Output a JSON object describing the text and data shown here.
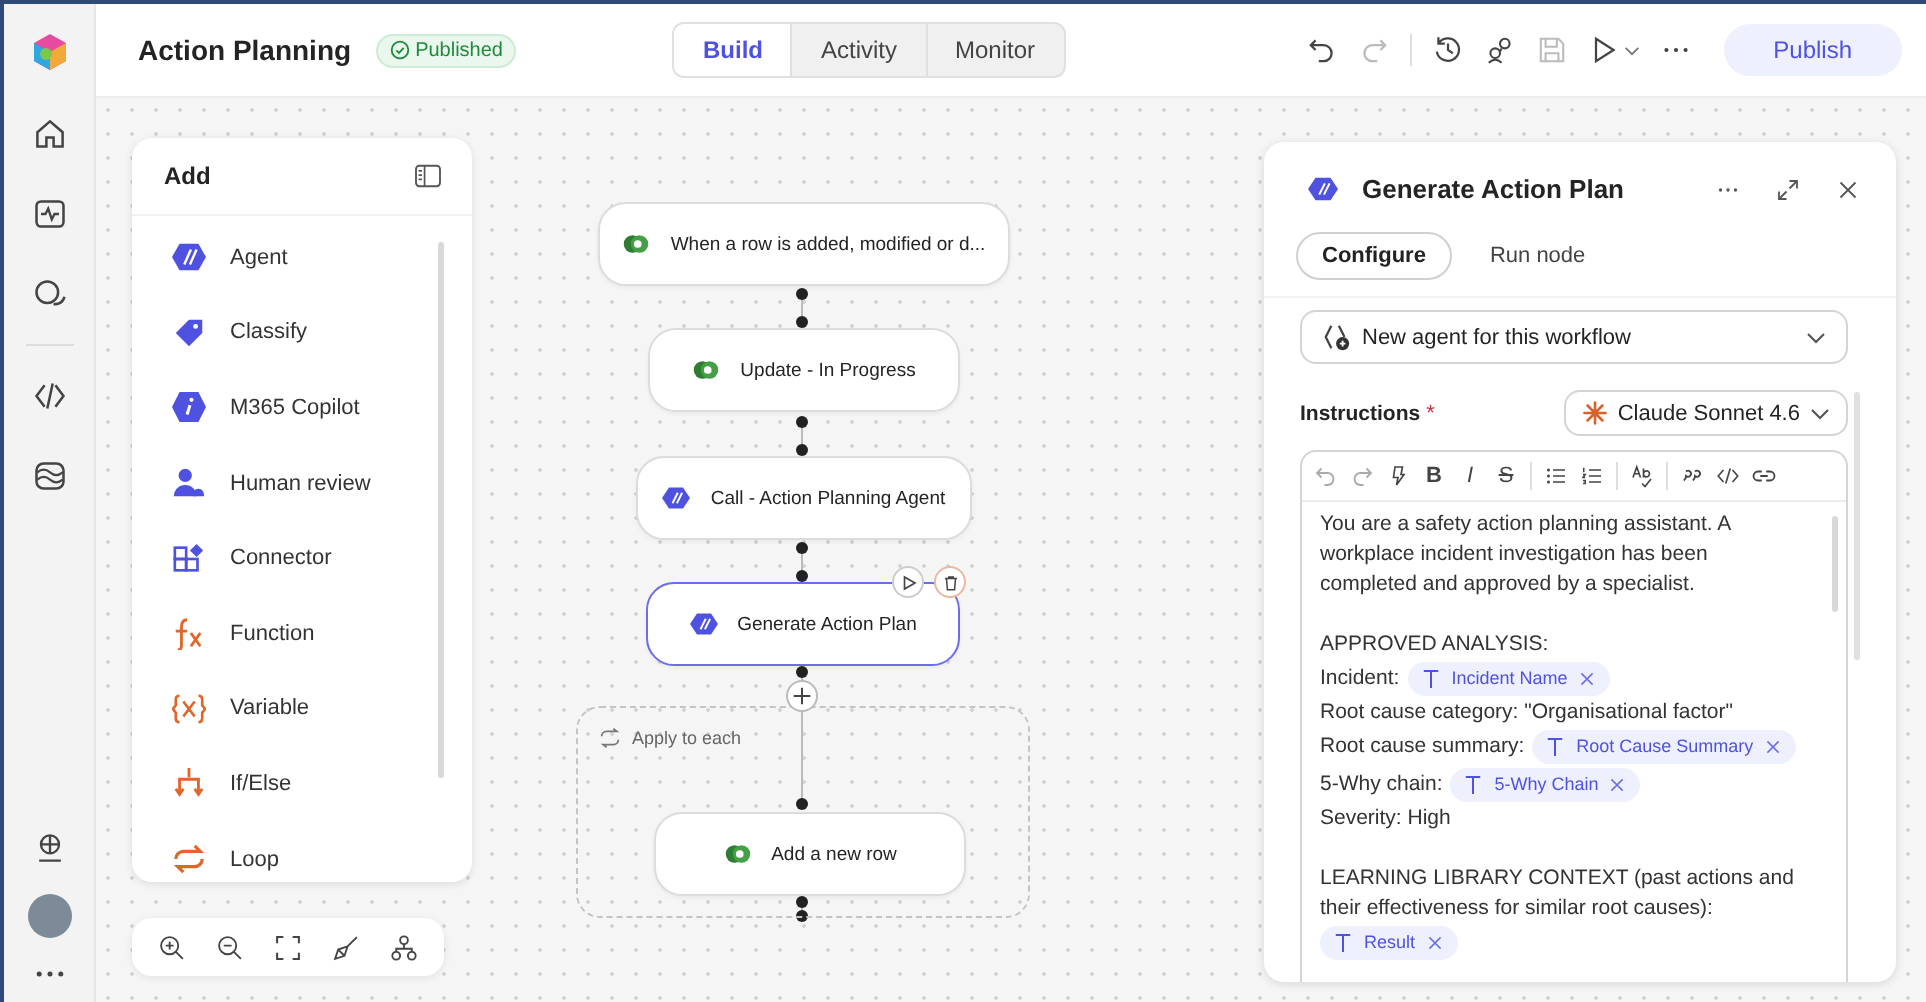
{
  "app": {
    "title": "Action Planning",
    "status": "Published"
  },
  "view_tabs": [
    {
      "label": "Build",
      "selected": true
    },
    {
      "label": "Activity",
      "selected": false
    },
    {
      "label": "Monitor",
      "selected": false
    }
  ],
  "publish_button": "Publish",
  "add_panel": {
    "title": "Add",
    "items": [
      {
        "label": "Agent",
        "kind": "agent"
      },
      {
        "label": "Classify",
        "kind": "classify"
      },
      {
        "label": "M365 Copilot",
        "kind": "copilot"
      },
      {
        "label": "Human review",
        "kind": "human"
      },
      {
        "label": "Connector",
        "kind": "connector"
      },
      {
        "label": "Function",
        "kind": "function"
      },
      {
        "label": "Variable",
        "kind": "variable"
      },
      {
        "label": "If/Else",
        "kind": "ifelse"
      },
      {
        "label": "Loop",
        "kind": "loop"
      }
    ]
  },
  "workflow": {
    "nodes": [
      {
        "label": "When a row is added, modified or d...",
        "kind": "dataverse",
        "selected": false
      },
      {
        "label": "Update - In Progress",
        "kind": "dataverse",
        "selected": false
      },
      {
        "label": "Call - Action Planning Agent",
        "kind": "agent",
        "selected": false
      },
      {
        "label": "Generate Action Plan",
        "kind": "agent",
        "selected": true
      }
    ],
    "group": {
      "label": "Apply to each",
      "nodes": [
        {
          "label": "Add a new row",
          "kind": "dataverse",
          "selected": false
        }
      ]
    }
  },
  "node_panel": {
    "title": "Generate Action Plan",
    "tabs": [
      {
        "label": "Configure",
        "selected": true
      },
      {
        "label": "Run node",
        "selected": false
      }
    ],
    "agent_select": "New agent for this workflow",
    "instructions": {
      "label": "Instructions",
      "required_mark": "*",
      "model": "Claude Sonnet 4.6"
    },
    "text_style_buttons": [
      {
        "label": "B",
        "kind": "bold"
      },
      {
        "label": "I",
        "kind": "italic"
      },
      {
        "label": "S",
        "kind": "strike"
      }
    ],
    "paragraphs": [
      {
        "lines": [
          {
            "parts": [
              {
                "kind": "text",
                "text": "You are a safety action planning assistant. A workplace incident investigation has been completed and approved by a specialist."
              }
            ]
          }
        ]
      },
      {
        "lines": [
          {
            "parts": [
              {
                "kind": "text",
                "text": "APPROVED ANALYSIS:"
              }
            ]
          },
          {
            "parts": [
              {
                "kind": "text",
                "text": "Incident:"
              },
              {
                "kind": "token",
                "text": "Incident Name"
              }
            ]
          },
          {
            "parts": [
              {
                "kind": "text",
                "text": "Root cause category: \"Organisational factor\""
              }
            ]
          },
          {
            "parts": [
              {
                "kind": "text",
                "text": "Root cause summary:"
              },
              {
                "kind": "token",
                "text": "Root Cause Summary"
              }
            ]
          },
          {
            "parts": [
              {
                "kind": "text",
                "text": "5-Why chain:"
              },
              {
                "kind": "token",
                "text": "5-Why Chain"
              }
            ]
          },
          {
            "parts": [
              {
                "kind": "text",
                "text": "Severity: High"
              }
            ]
          }
        ]
      },
      {
        "lines": [
          {
            "parts": [
              {
                "kind": "text",
                "text": "LEARNING LIBRARY CONTEXT (past actions and their effectiveness for similar root causes):"
              }
            ]
          },
          {
            "parts": [
              {
                "kind": "token",
                "text": "Result"
              }
            ]
          }
        ]
      }
    ]
  }
}
